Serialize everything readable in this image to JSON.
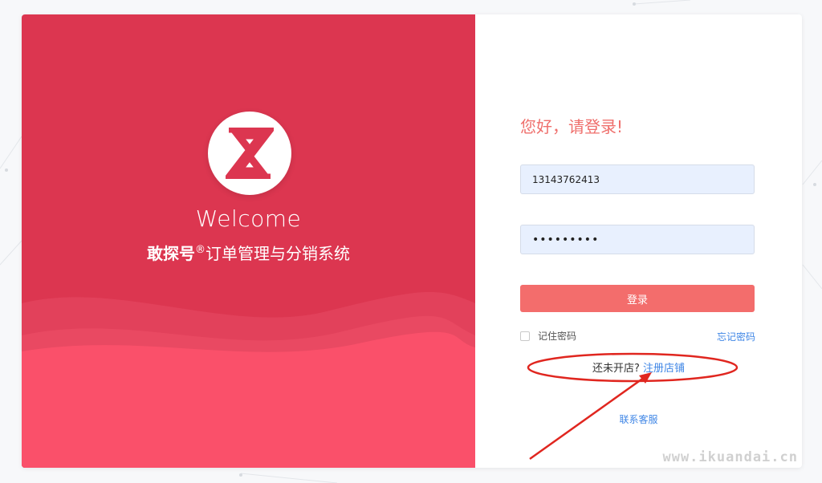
{
  "branding": {
    "welcome": "Welcome",
    "brand_name": "敢探号",
    "registered_mark": "®",
    "system_suffix": "订单管理与分销系统",
    "logo_icon": "hourglass-logo-icon",
    "primary_color": "#dc3650"
  },
  "login": {
    "greeting": "您好，请登录!",
    "phone_value": "13143762413",
    "password_value": "•••••••••",
    "submit_label": "登录",
    "remember_label": "记住密码",
    "forgot_label": "忘记密码",
    "no_shop_text": "还未开店?",
    "register_label": "注册店铺",
    "contact_label": "联系客服",
    "accent_color": "#f36d6c",
    "link_color": "#3f86e6"
  },
  "watermark": "www.ikuandai.cn"
}
